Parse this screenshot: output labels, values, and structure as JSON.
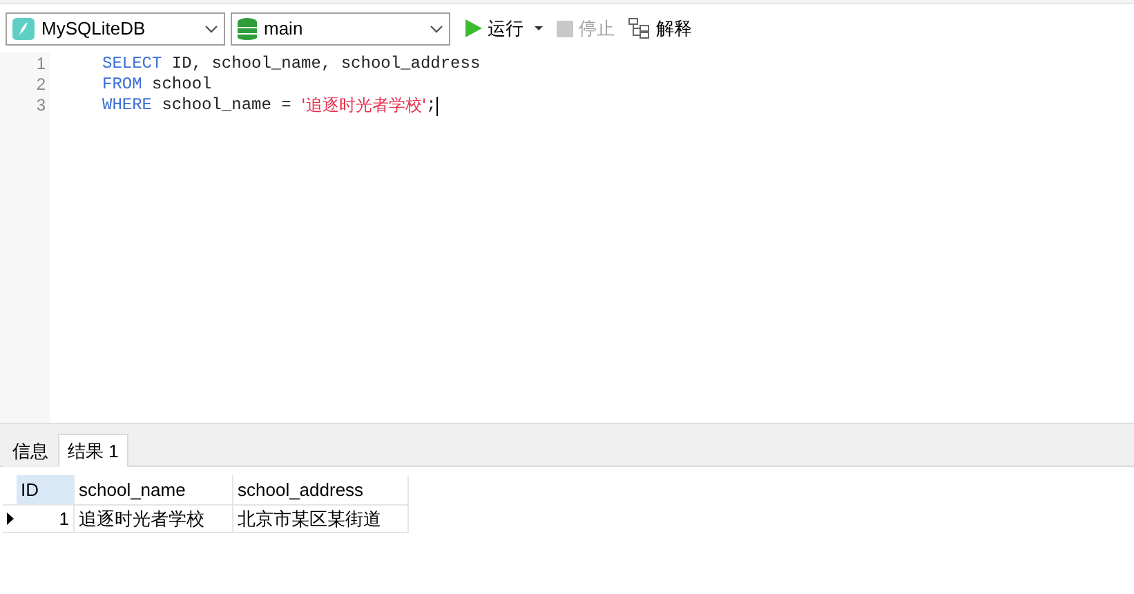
{
  "toolbar": {
    "connection": "MySQLiteDB",
    "database": "main",
    "buttons": [
      {
        "kind": "run",
        "label": "运行",
        "disabled": false
      },
      {
        "kind": "stop",
        "label": "停止",
        "disabled": true
      },
      {
        "kind": "explain",
        "label": "解释",
        "disabled": false
      }
    ]
  },
  "editor": {
    "lines": [
      {
        "number": "1",
        "tokens": [
          {
            "kind": "keyword",
            "text": "SELECT"
          },
          {
            "kind": "plain",
            "text": " ID, school_name, school_address"
          }
        ]
      },
      {
        "number": "2",
        "tokens": [
          {
            "kind": "keyword",
            "text": "FROM"
          },
          {
            "kind": "plain",
            "text": " school"
          }
        ]
      },
      {
        "number": "3",
        "tokens": [
          {
            "kind": "keyword",
            "text": "WHERE"
          },
          {
            "kind": "plain",
            "text": " school_name = "
          },
          {
            "kind": "string",
            "text": "'追逐时光者学校'"
          },
          {
            "kind": "plain",
            "text": ";"
          }
        ]
      }
    ]
  },
  "tabs": [
    {
      "label": "信息",
      "selected": false
    },
    {
      "label": "结果 1",
      "selected": true
    }
  ],
  "table": {
    "columns": [
      {
        "label": "ID",
        "selected": true
      },
      {
        "label": "school_name",
        "selected": false
      },
      {
        "label": "school_address",
        "selected": false
      }
    ],
    "rows": [
      {
        "current": true,
        "cells": [
          "1",
          "追逐时光者学校",
          "北京市某区某街道"
        ]
      }
    ]
  }
}
